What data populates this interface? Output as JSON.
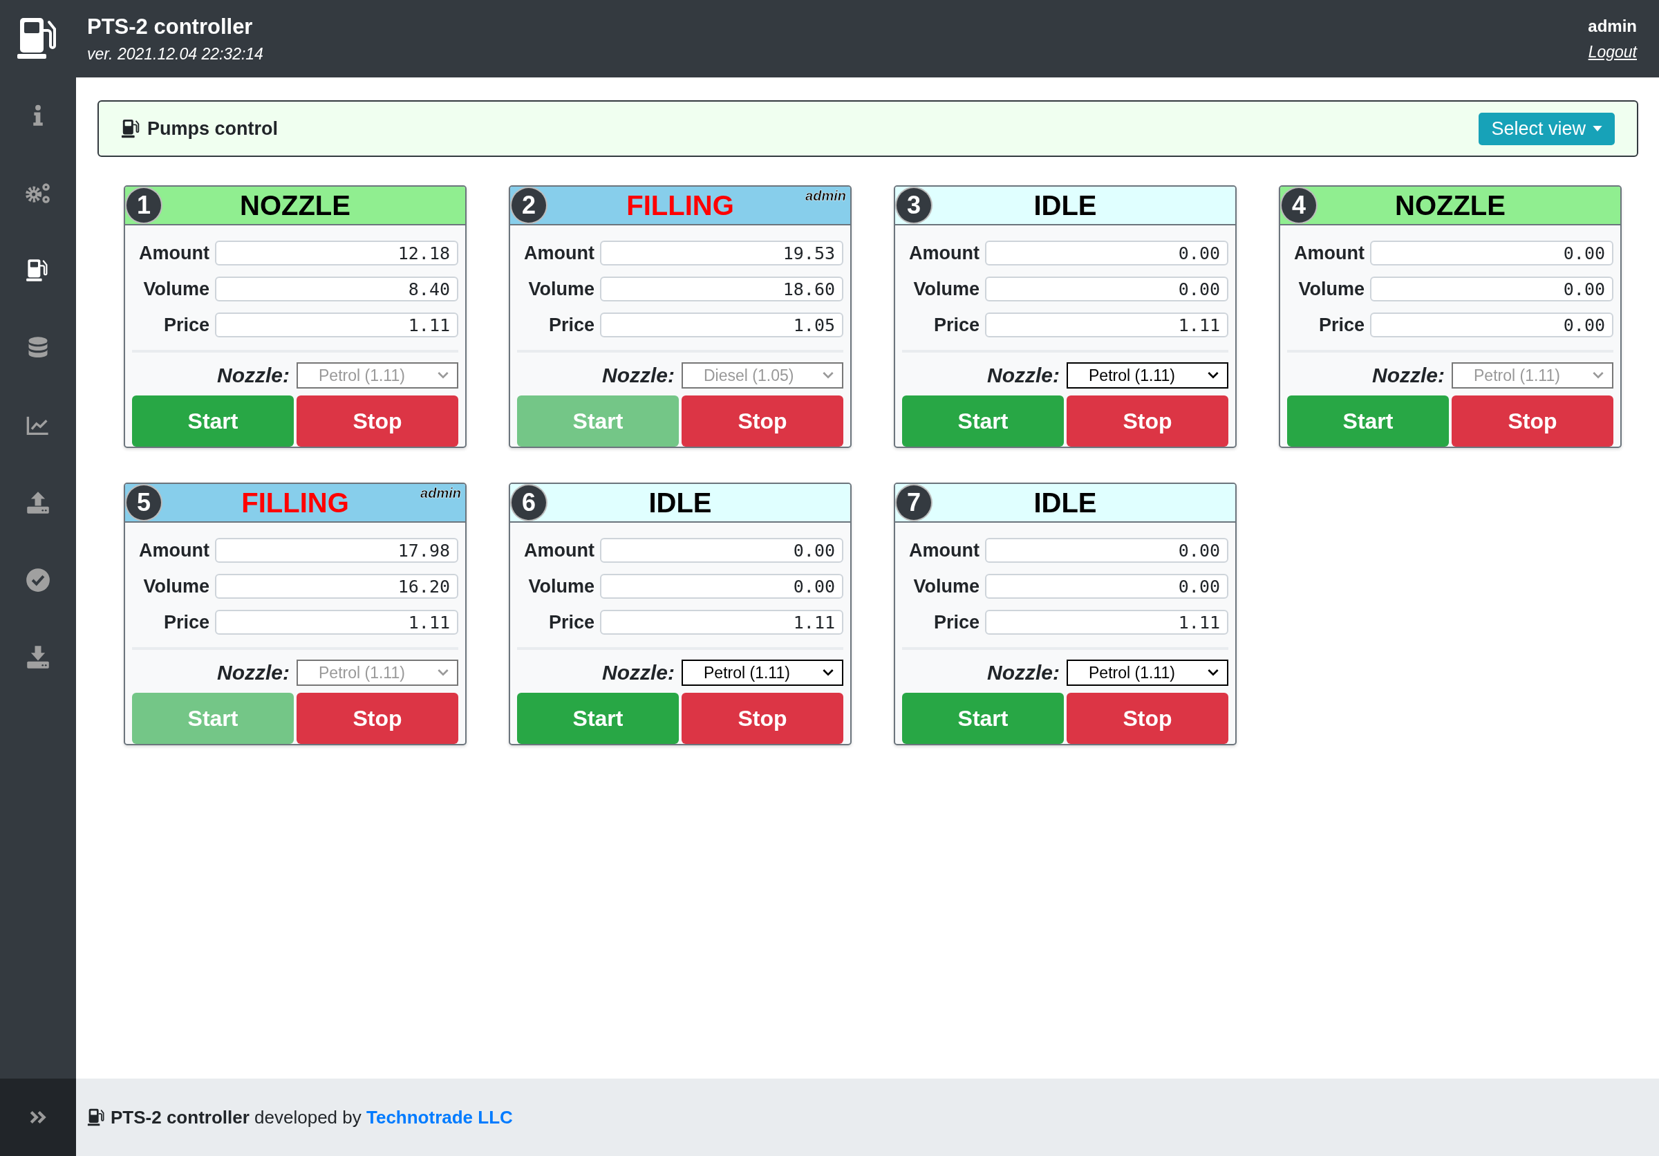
{
  "header": {
    "title": "PTS-2 controller",
    "version": "ver. 2021.12.04 22:32:14",
    "user": "admin",
    "logout": "Logout"
  },
  "sidebar": {
    "items": [
      {
        "kind": "info",
        "selected": false
      },
      {
        "kind": "gears",
        "selected": false
      },
      {
        "kind": "pump",
        "selected": true
      },
      {
        "kind": "database",
        "selected": false
      },
      {
        "kind": "chart",
        "selected": false
      },
      {
        "kind": "upload",
        "selected": false
      },
      {
        "kind": "check",
        "selected": false
      },
      {
        "kind": "download",
        "selected": false
      }
    ]
  },
  "panel": {
    "title": "Pumps control",
    "button": "Select view"
  },
  "pumps": [
    {
      "number": "1",
      "status": {
        "kind": "nozzle",
        "label": "NOZZLE"
      },
      "fields": [
        {
          "label": "Amount",
          "value": "12.18"
        },
        {
          "label": "Volume",
          "value": "8.40"
        },
        {
          "label": "Price",
          "value": "1.11"
        }
      ],
      "nozzle_label": "Nozzle:",
      "nozzle": {
        "value": "Petrol (1.11)",
        "disabled": true
      },
      "start": {
        "label": "Start",
        "disabled": false
      },
      "stop": {
        "label": "Stop"
      }
    },
    {
      "number": "2",
      "status": {
        "kind": "filling",
        "label": "FILLING"
      },
      "user": "admin",
      "fields": [
        {
          "label": "Amount",
          "value": "19.53"
        },
        {
          "label": "Volume",
          "value": "18.60"
        },
        {
          "label": "Price",
          "value": "1.05"
        }
      ],
      "nozzle_label": "Nozzle:",
      "nozzle": {
        "value": "Diesel (1.05)",
        "disabled": true
      },
      "start": {
        "label": "Start",
        "disabled": true
      },
      "stop": {
        "label": "Stop"
      }
    },
    {
      "number": "3",
      "status": {
        "kind": "idle",
        "label": "IDLE"
      },
      "fields": [
        {
          "label": "Amount",
          "value": "0.00"
        },
        {
          "label": "Volume",
          "value": "0.00"
        },
        {
          "label": "Price",
          "value": "1.11"
        }
      ],
      "nozzle_label": "Nozzle:",
      "nozzle": {
        "value": "Petrol (1.11)",
        "disabled": false
      },
      "start": {
        "label": "Start",
        "disabled": false
      },
      "stop": {
        "label": "Stop"
      }
    },
    {
      "number": "4",
      "status": {
        "kind": "nozzle",
        "label": "NOZZLE"
      },
      "fields": [
        {
          "label": "Amount",
          "value": "0.00"
        },
        {
          "label": "Volume",
          "value": "0.00"
        },
        {
          "label": "Price",
          "value": "0.00"
        }
      ],
      "nozzle_label": "Nozzle:",
      "nozzle": {
        "value": "Petrol (1.11)",
        "disabled": true
      },
      "start": {
        "label": "Start",
        "disabled": false
      },
      "stop": {
        "label": "Stop"
      }
    },
    {
      "number": "5",
      "status": {
        "kind": "filling",
        "label": "FILLING"
      },
      "user": "admin",
      "fields": [
        {
          "label": "Amount",
          "value": "17.98"
        },
        {
          "label": "Volume",
          "value": "16.20"
        },
        {
          "label": "Price",
          "value": "1.11"
        }
      ],
      "nozzle_label": "Nozzle:",
      "nozzle": {
        "value": "Petrol (1.11)",
        "disabled": true
      },
      "start": {
        "label": "Start",
        "disabled": true
      },
      "stop": {
        "label": "Stop"
      }
    },
    {
      "number": "6",
      "status": {
        "kind": "idle",
        "label": "IDLE"
      },
      "fields": [
        {
          "label": "Amount",
          "value": "0.00"
        },
        {
          "label": "Volume",
          "value": "0.00"
        },
        {
          "label": "Price",
          "value": "1.11"
        }
      ],
      "nozzle_label": "Nozzle:",
      "nozzle": {
        "value": "Petrol (1.11)",
        "disabled": false
      },
      "start": {
        "label": "Start",
        "disabled": false
      },
      "stop": {
        "label": "Stop"
      }
    },
    {
      "number": "7",
      "status": {
        "kind": "idle",
        "label": "IDLE"
      },
      "fields": [
        {
          "label": "Amount",
          "value": "0.00"
        },
        {
          "label": "Volume",
          "value": "0.00"
        },
        {
          "label": "Price",
          "value": "1.11"
        }
      ],
      "nozzle_label": "Nozzle:",
      "nozzle": {
        "value": "Petrol (1.11)",
        "disabled": false
      },
      "start": {
        "label": "Start",
        "disabled": false
      },
      "stop": {
        "label": "Stop"
      }
    }
  ],
  "footer": {
    "text": "**PTS-2 controller** developed by",
    "link": "Technotrade LLC"
  }
}
